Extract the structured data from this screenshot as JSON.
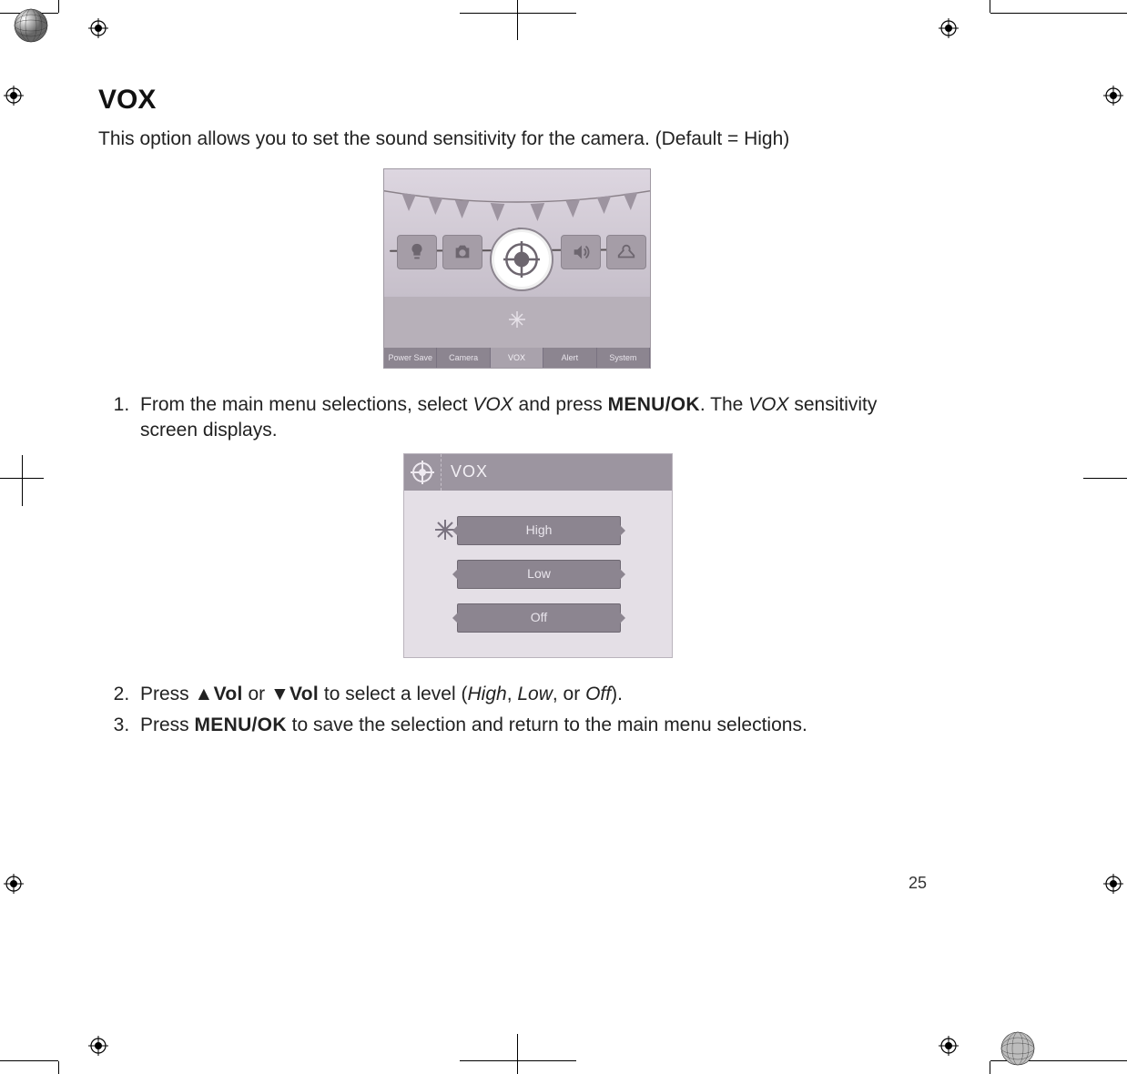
{
  "page_number": "25",
  "heading": "VOX",
  "intro": "This option allows you to set the sound sensitivity for the camera. (Default = High)",
  "steps": {
    "s1_a": "From the main menu selections, select ",
    "s1_vox": "VOX",
    "s1_b": " and press ",
    "s1_menu": "MENU/OK",
    "s1_c": ". The ",
    "s1_vox2": "VOX",
    "s1_d": " sensitivity screen displays.",
    "s2_a": "Press ",
    "s2_up": "▲Vol",
    "s2_b": " or ",
    "s2_dn": "▼Vol",
    "s2_c": " to select a level (",
    "s2_high": "High",
    "s2_comma1": ", ",
    "s2_low": "Low",
    "s2_comma2": ", or ",
    "s2_off": "Off",
    "s2_end": ").",
    "s3_a": "Press ",
    "s3_menu": "MENU/OK",
    "s3_b": " to save the selection and return to the main menu selections."
  },
  "main_menu_tabs": {
    "t0": "Power Save",
    "t1": "Camera",
    "t2": "VOX",
    "t3": "Alert",
    "t4": "System"
  },
  "vox_screen": {
    "title": "VOX",
    "opt_high": "High",
    "opt_low": "Low",
    "opt_off": "Off"
  }
}
